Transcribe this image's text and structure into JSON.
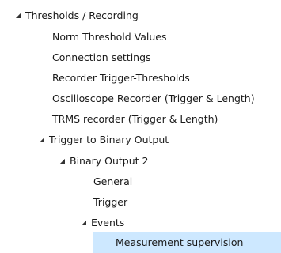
{
  "tree": {
    "items": [
      {
        "label": "Thresholds / Recording",
        "arrow": "◢"
      },
      {
        "label": "Norm Threshold Values"
      },
      {
        "label": "Connection settings"
      },
      {
        "label": "Recorder Trigger-Thresholds"
      },
      {
        "label": "Oscilloscope Recorder (Trigger & Length)"
      },
      {
        "label": "TRMS recorder (Trigger & Length)"
      },
      {
        "label": "Trigger to Binary Output",
        "arrow": "◢"
      },
      {
        "label": "Binary Output 2",
        "arrow": "◢"
      },
      {
        "label": "General"
      },
      {
        "label": "Trigger"
      },
      {
        "label": "Events",
        "arrow": "◢"
      },
      {
        "label": "Measurement supervision",
        "selected": true
      }
    ]
  }
}
